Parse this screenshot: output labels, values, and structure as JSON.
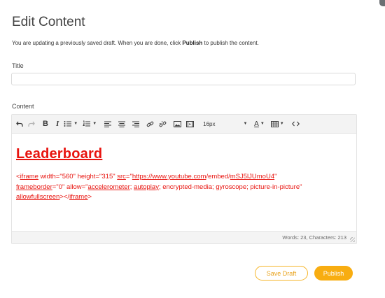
{
  "page": {
    "title": "Edit Content",
    "description_pre": "You are updating a previously saved draft. When you are done, click ",
    "description_bold": "Publish",
    "description_post": " to publish the content."
  },
  "form": {
    "title_label": "Title",
    "title_value": "",
    "content_label": "Content"
  },
  "toolbar": {
    "icons": [
      "undo-icon",
      "redo-icon",
      "bold-icon",
      "italic-icon",
      "bullet-list-icon",
      "numbered-list-icon",
      "align-left-icon",
      "align-center-icon",
      "align-right-icon",
      "link-icon",
      "unlink-icon",
      "image-icon",
      "media-icon",
      "font-size-select",
      "text-color-icon",
      "table-icon",
      "source-code-icon"
    ],
    "font_size": "16px"
  },
  "editor": {
    "heading": "Leaderboard",
    "code": {
      "t1": "<",
      "iframe_open": "iframe",
      "t2": " width=\"560\" height=\"315\" ",
      "src": "src",
      "t3": "=\"",
      "url": "https://www.youtube.com",
      "t4": "/embed/",
      "vid": "mSJ5lJUmoU4",
      "t5": "\"",
      "frameborder": "frameborder",
      "t6": "=\"0\" allow=\"",
      "accelerometer": "accelerometer",
      "t7": "; ",
      "autoplay": "autoplay",
      "t8": "; encrypted-media; gyroscope; picture-in-picture\"",
      "allowfullscreen": "allowfullscreen",
      "t9": "></",
      "iframe_close": "iframe",
      "t10": ">"
    },
    "word_count": "Words: 23, Characters: 213"
  },
  "actions": {
    "save_draft": "Save Draft",
    "publish": "Publish"
  },
  "colors": {
    "accent": "#f8ad11",
    "content_red": "#e8140f"
  }
}
